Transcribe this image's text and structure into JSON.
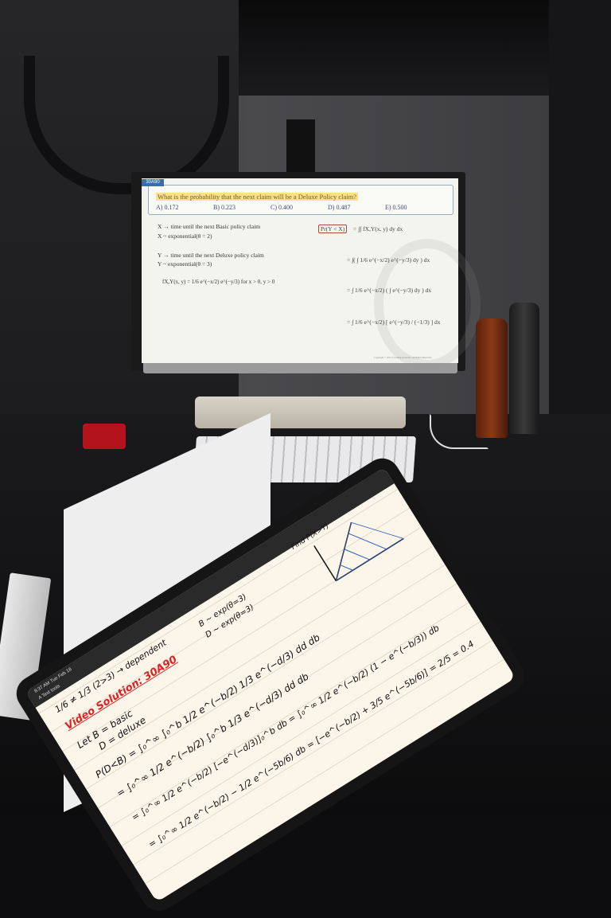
{
  "monitor": {
    "tag": "30A90",
    "question": "What is the probability that the next claim will be a Deluxe Policy claim?",
    "options": [
      "A) 0.172",
      "B) 0.223",
      "C) 0.400",
      "D) 0.487",
      "E) 0.500"
    ],
    "x_def": "X → time until the next Basic policy claim",
    "x_dist": "X ~ exponential(θ = 2)",
    "y_def": "Y → time until the next Deluxe policy claim",
    "y_dist": "Y ~ exponential(θ = 3)",
    "joint": "fX,Y(x, y) = 1/6 e^(−x/2) e^(−y/3)   for x > 0, y > 0",
    "pr": "Pr(Y < X)",
    "eq1": "= ∫∫ fX,Y(x, y) dy dx",
    "eq2": "= ∫( ∫ 1/6 e^(−x/2) e^(−y/3) dy ) dx",
    "eq3": "= ∫ 1/6 e^(−x/2) ( ∫ e^(−y/3) dy ) dx",
    "eq4": "= ∫ 1/6 e^(−x/2) [ e^(−y/3) / (−1/3) ] dx",
    "copyright": "Copyright © 2013 Coaching Actuaries. All Rights Reserved."
  },
  "tablet": {
    "status_time": "8:37 AM  Tue Feb 18",
    "toolbar_label": "A  Text tools",
    "title": "Video Solution: 30A90",
    "find_label": "Find P(X>Y)",
    "notes": [
      "1/6 ≠ 1/3 (2>3) → dependent",
      "Let B = basic",
      "D = deluxe",
      "B ~ exp(θ=3)",
      "D ~ exp(θ=3)",
      "P(D<B) = ∫₀^∞ ∫₀^b 1/2 e^(−b/2) 1/3 e^(−d/3) dd db",
      "= ∫₀^∞ 1/2 e^(−b/2) ∫₀^b 1/3 e^(−d/3) dd db",
      "= ∫₀^∞ 1/2 e^(−b/2) [−e^(−d/3)]₀^b db = ∫₀^∞ 1/2 e^(−b/2) (1 − e^(−b/3)) db",
      "= ∫₀^∞ 1/2 e^(−b/2) − 1/2 e^(−5b/6) db = [−e^(−b/2) + 3/5 e^(−5b/6)] = 2/5 = 0.4"
    ]
  }
}
